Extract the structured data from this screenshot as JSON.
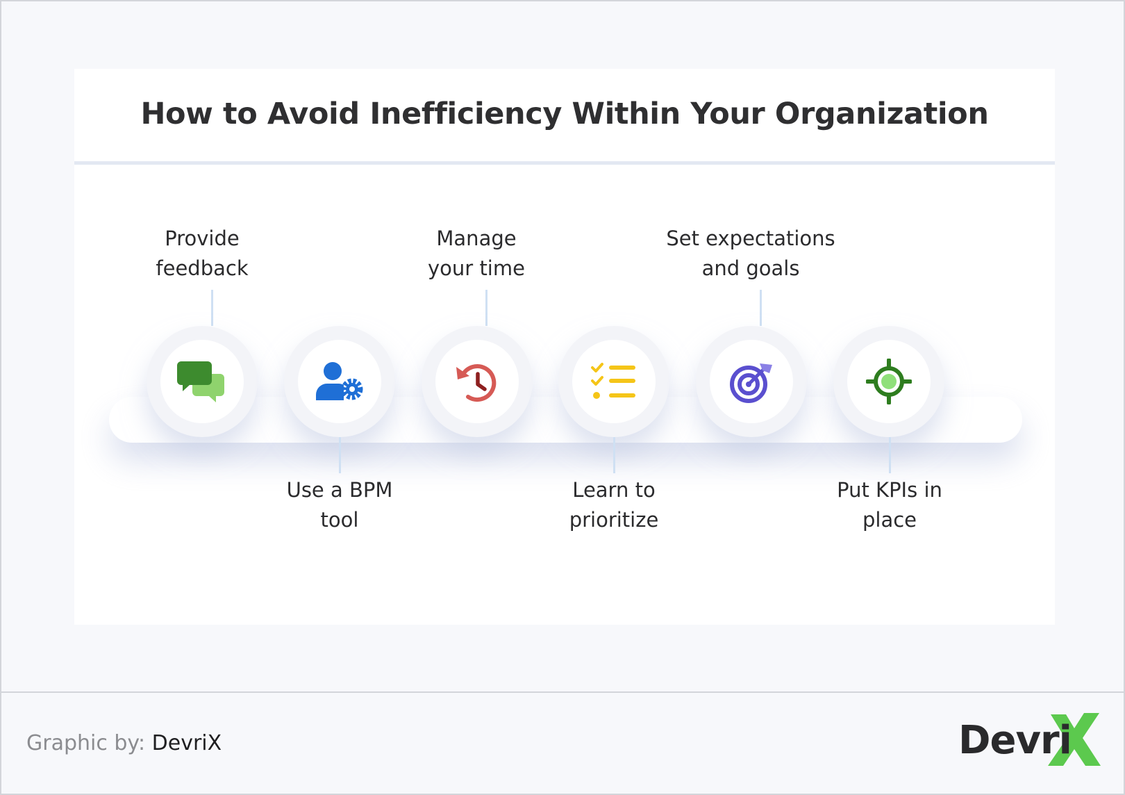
{
  "title": "How to Avoid Inefficiency Within Your Organization",
  "steps": [
    {
      "id": "feedback",
      "label_lines": [
        "Provide",
        "feedback"
      ],
      "position": "top",
      "icon": "chat-bubbles-icon",
      "color": "#3d8b2e",
      "color2": "#8fd36d"
    },
    {
      "id": "bpm",
      "label_lines": [
        "Use a BPM",
        "tool"
      ],
      "position": "bottom",
      "icon": "user-gear-icon",
      "color": "#1f6fd6",
      "color2": "#1f6fd6"
    },
    {
      "id": "time",
      "label_lines": [
        "Manage",
        "your time"
      ],
      "position": "top",
      "icon": "clock-history-icon",
      "color": "#d65a55",
      "color2": "#8e1f1f"
    },
    {
      "id": "prioritize",
      "label_lines": [
        "Learn to",
        "prioritize"
      ],
      "position": "bottom",
      "icon": "checklist-icon",
      "color": "#f5c518",
      "color2": "#f5c518"
    },
    {
      "id": "goals",
      "label_lines": [
        "Set expectations",
        "and goals"
      ],
      "position": "top",
      "icon": "target-arrow-icon",
      "color": "#5a4fcf",
      "color2": "#8a80e6"
    },
    {
      "id": "kpis",
      "label_lines": [
        "Put KPIs in",
        "place"
      ],
      "position": "bottom",
      "icon": "crosshair-icon",
      "color": "#2e7d1f",
      "color2": "#8fe07a"
    }
  ],
  "footer": {
    "credit_prefix": "Graphic by:",
    "credit_brand": "DevriX",
    "logo_text": "Devri",
    "logo_accent": "#5cc94e"
  }
}
